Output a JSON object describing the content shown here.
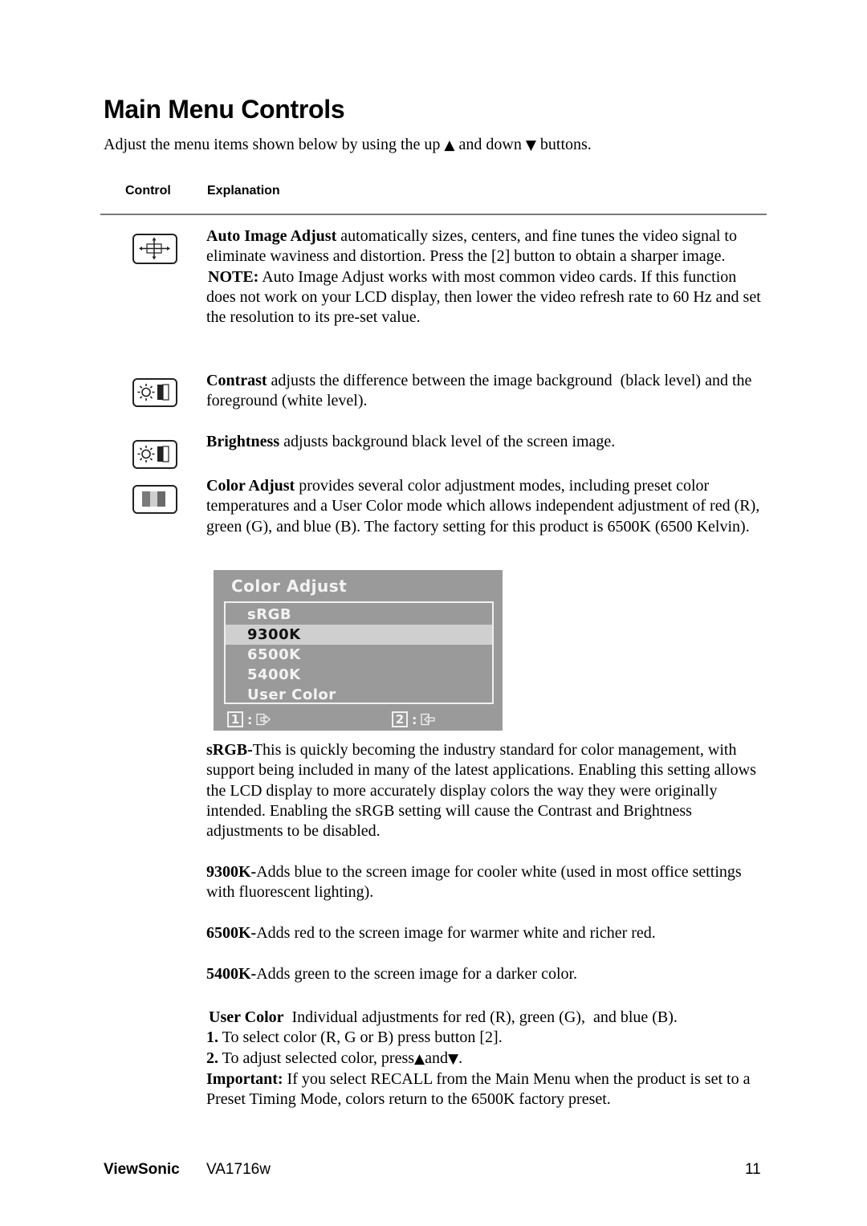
{
  "page": {
    "title": "Main Menu Controls",
    "intro": {
      "before": "Adjust the menu items shown below by using the up ",
      "up_symbol": "▲",
      "middle": " and down ",
      "down_symbol": "▼",
      "after": " buttons."
    },
    "table_header": {
      "control": "Control",
      "explanation": "Explanation"
    }
  },
  "controls": [
    {
      "icon": "auto-image-adjust-icon",
      "term": "Auto Image Adjust",
      "text": " automatically sizes, centers, and fine tunes the video signal to eliminate waviness and distortion. Press the [2] button to obtain a sharper image.",
      "note_label": "NOTE:",
      "note_text": " Auto Image Adjust works with most common video cards. If this function does not work on your LCD display, then lower the video refresh rate to 60 Hz and set the resolution to its pre-set value."
    },
    {
      "icon": "contrast-icon",
      "term": "Contrast",
      "text": " adjusts the difference between the image background  (black level) and the foreground (white level)."
    },
    {
      "icon": "brightness-icon",
      "term": "Brightness",
      "text": " adjusts background black level of the screen image."
    },
    {
      "icon": "color-adjust-icon",
      "term": "Color Adjust",
      "text": " provides several color adjustment modes, including preset color temperatures and a User Color mode which allows independent adjustment of red (R), green (G), and blue (B). The factory setting for this product is 6500K (6500 Kelvin)."
    }
  ],
  "osd": {
    "title": "Color Adjust",
    "items": [
      "sRGB",
      "9300K",
      "6500K",
      "5400K",
      "User Color"
    ],
    "selected": "9300K",
    "footer": [
      {
        "key": "1",
        "sep": ":",
        "icon": "exit-icon"
      },
      {
        "key": "2",
        "sep": ":",
        "icon": "enter-icon"
      }
    ],
    "colors": {
      "background": "#9a9a9a",
      "highlight": "#cfcfcf",
      "text": "#f3f3f3"
    }
  },
  "modes": [
    {
      "term": "sRGB-",
      "text": "This is quickly becoming the industry standard for color management, with support being included in many of the latest applications. Enabling this setting allows the LCD display to more accurately display colors the way they were originally intended. Enabling the sRGB setting will cause the Contrast and Brightness adjustments to be disabled."
    },
    {
      "term": "9300K-",
      "text": "Adds blue to the screen image for cooler white (used in most office settings with fluorescent lighting)."
    },
    {
      "term": "6500K-",
      "text": "Adds red to the screen image for warmer white and richer red."
    },
    {
      "term": "5400K-",
      "text": "Adds green to the screen image for a darker color."
    }
  ],
  "user_color": {
    "term": "User Color",
    "text": "  Individual adjustments for red (R), green (G),  and blue (B).",
    "steps": [
      {
        "num": "1.",
        "text": " To select color (R, G or B) press button [2]."
      },
      {
        "num": "2.",
        "text_before": " To adjust selected color, press",
        "up": "▲",
        "mid": "and",
        "down": "▼",
        "text_after": "."
      }
    ],
    "important_label": "Important:",
    "important_text": " If you select RECALL from the Main Menu when the product is set to a Preset Timing Mode, colors return to the 6500K factory preset."
  },
  "footer": {
    "brand": "ViewSonic",
    "model": "VA1716w",
    "page_number": "11"
  }
}
